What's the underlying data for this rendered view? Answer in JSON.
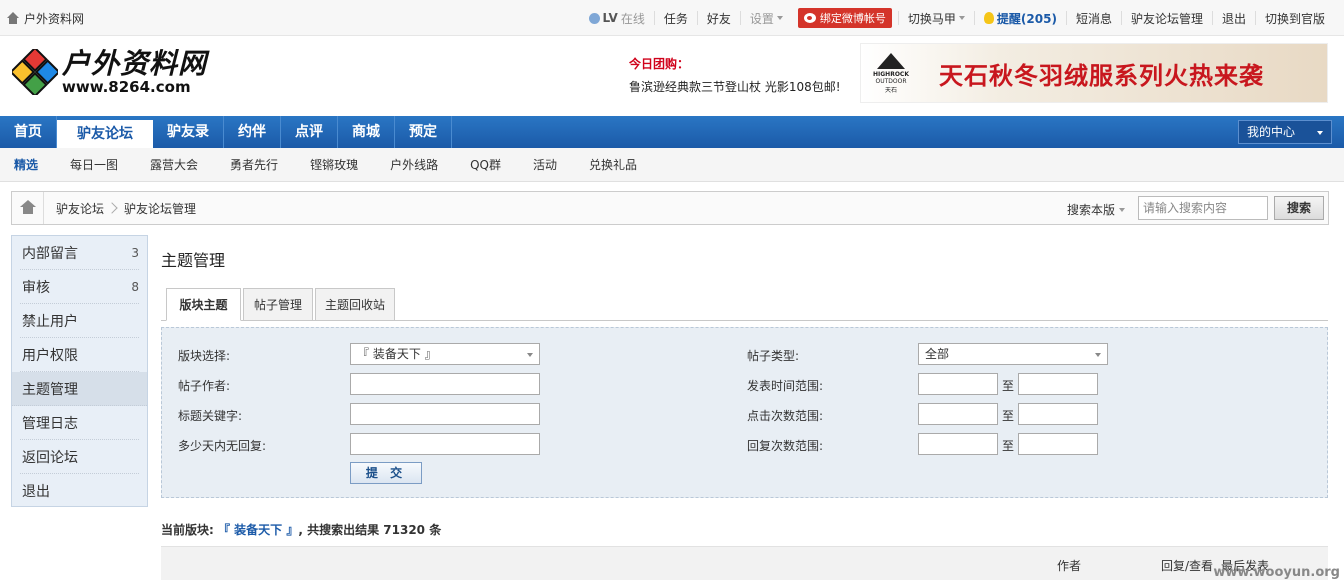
{
  "topbar": {
    "site_name": "户外资料网",
    "user_level": "LV",
    "user_status": "在线",
    "links": [
      "任务",
      "好友"
    ],
    "settings": "设置",
    "weibo_bind": "绑定微博帐号",
    "switch_vest": "切换马甲",
    "reminder": "提醒(205)",
    "messages": "短消息",
    "forum_admin": "驴友论坛管理",
    "logout": "退出",
    "switch_official": "切换到官版"
  },
  "header": {
    "logo_cn": "户外资料网",
    "logo_url": "www.8264.com",
    "deal_title": "今日团购：",
    "deal_text": "鲁滨逊经典款三节登山杖 光影108包邮!",
    "banner_brand": "HIGHROCK",
    "banner_brand_sub1": "OUTDOOR",
    "banner_brand_sub2": "天石",
    "banner_text": "天石秋冬羽绒服系列火热来袭"
  },
  "mainnav": {
    "tabs": [
      "首页",
      "驴友论坛",
      "驴友录",
      "约伴",
      "点评",
      "商城",
      "预定"
    ],
    "active_index": 1,
    "my_center": "我的中心"
  },
  "subnav": {
    "items": [
      "精选",
      "每日一图",
      "露营大会",
      "勇者先行",
      "铿锵玫瑰",
      "户外线路",
      "QQ群",
      "活动",
      "兑换礼品"
    ]
  },
  "breadcrumb": {
    "items": [
      "驴友论坛",
      "驴友论坛管理"
    ],
    "search_scope": "搜索本版",
    "search_placeholder": "请输入搜索内容",
    "search_button": "搜索"
  },
  "leftmenu": {
    "items": [
      {
        "label": "内部留言",
        "count": "3"
      },
      {
        "label": "审核",
        "count": "8"
      },
      {
        "label": "禁止用户",
        "count": ""
      },
      {
        "label": "用户权限",
        "count": ""
      },
      {
        "label": "主题管理",
        "count": ""
      },
      {
        "label": "管理日志",
        "count": ""
      },
      {
        "label": "返回论坛",
        "count": ""
      },
      {
        "label": "退出",
        "count": ""
      }
    ],
    "active_index": 4
  },
  "content": {
    "title": "主题管理",
    "tabs": [
      "版块主题",
      "帖子管理",
      "主题回收站"
    ],
    "filters": {
      "forum_label": "版块选择:",
      "forum_value": "『 装备天下 』",
      "author_label": "帖子作者:",
      "keyword_label": "标题关键字:",
      "noreply_label": "多少天内无回复:",
      "type_label": "帖子类型:",
      "type_value": "全部",
      "time_label": "发表时间范围:",
      "clicks_label": "点击次数范围:",
      "replies_label": "回复次数范围:",
      "to": "至",
      "submit": "提 交"
    },
    "result_prefix": "当前版块:",
    "result_forum": "『 装备天下 』",
    "result_suffix": ", 共搜索出结果 71320 条",
    "table_headers": [
      "作者",
      "回复/查看",
      "最后发表"
    ]
  },
  "watermark": "www.wooyun.org"
}
